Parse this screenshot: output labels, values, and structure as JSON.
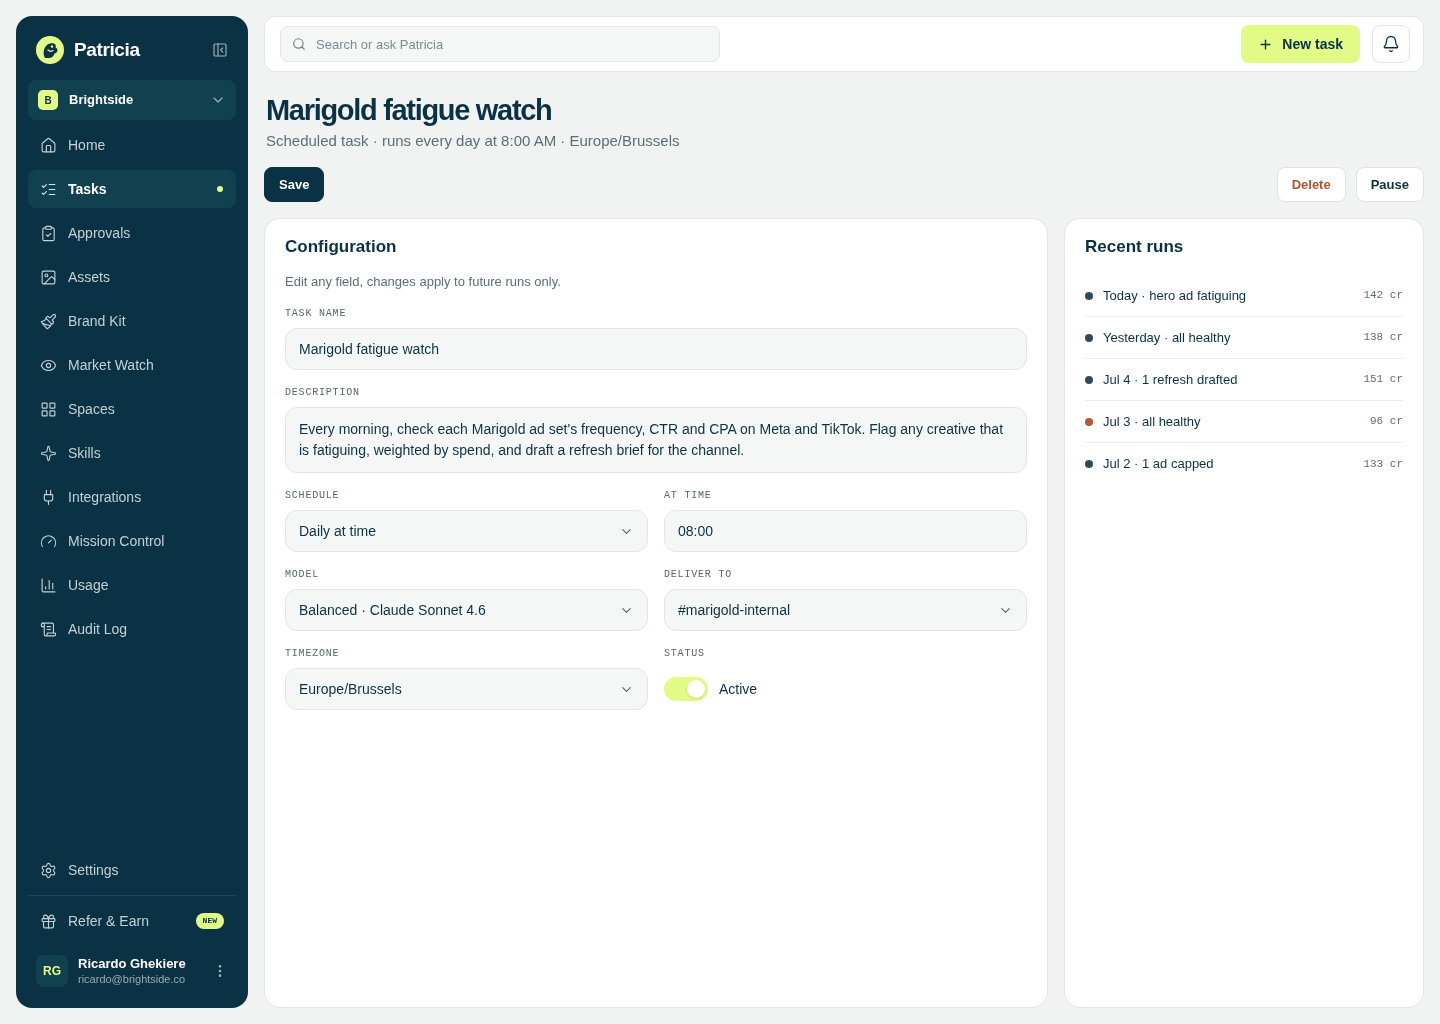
{
  "sidebar": {
    "brand": "Patricia",
    "workspace": {
      "badge": "B",
      "name": "Brightside"
    },
    "nav": [
      {
        "label": "Home",
        "selected": false,
        "has_update": false
      },
      {
        "label": "Tasks",
        "selected": true,
        "has_update": true
      },
      {
        "label": "Approvals",
        "selected": false,
        "has_update": false
      },
      {
        "label": "Assets",
        "selected": false,
        "has_update": false
      },
      {
        "label": "Brand Kit",
        "selected": false,
        "has_update": false
      },
      {
        "label": "Market Watch",
        "selected": false,
        "has_update": false
      },
      {
        "label": "Spaces",
        "selected": false,
        "has_update": false
      },
      {
        "label": "Skills",
        "selected": false,
        "has_update": false
      },
      {
        "label": "Integrations",
        "selected": false,
        "has_update": false
      },
      {
        "label": "Mission Control",
        "selected": false,
        "has_update": false
      },
      {
        "label": "Usage",
        "selected": false,
        "has_update": false
      },
      {
        "label": "Audit Log",
        "selected": false,
        "has_update": false
      }
    ],
    "settings": {
      "label": "Settings"
    },
    "refer": {
      "label": "Refer & Earn",
      "badge": "NEW"
    },
    "user": {
      "initials": "RG",
      "name": "Ricardo Ghekiere",
      "email": "ricardo@brightside.co"
    }
  },
  "topbar": {
    "search": {
      "placeholder": "Search or ask Patricia"
    },
    "new_task_button": "New task"
  },
  "header": {
    "title": "Marigold fatigue watch",
    "subtitle": "Scheduled task · runs every day at 8:00 AM · Europe/Brussels",
    "buttons": [
      {
        "label": "Save",
        "kind": "primary"
      },
      {
        "label": "Delete",
        "kind": "danger"
      },
      {
        "label": "Pause",
        "kind": "secondary"
      }
    ]
  },
  "configuration": {
    "title": "Configuration",
    "hint": "Edit any field, changes apply to future runs only.",
    "fields": [
      {
        "label": "TASK NAME",
        "kind": "text",
        "value": "Marigold fatigue watch"
      },
      {
        "label": "DESCRIPTION",
        "kind": "textarea",
        "value": "Every morning, check each Marigold ad set's frequency, CTR and CPA on Meta and TikTok. Flag any creative that is fatiguing, weighted by spend, and draft a refresh brief for the channel."
      }
    ],
    "grid": [
      {
        "label": "SCHEDULE",
        "kind": "select",
        "value": "Daily at time"
      },
      {
        "label": "AT TIME",
        "kind": "text",
        "value": "08:00"
      },
      {
        "label": "MODEL",
        "kind": "select",
        "value": "Balanced · Claude Sonnet 4.6"
      },
      {
        "label": "DELIVER TO",
        "kind": "select",
        "value": "#marigold-internal"
      },
      {
        "label": "TIMEZONE",
        "kind": "select",
        "value": "Europe/Brussels"
      },
      {
        "label": "STATUS",
        "kind": "toggle",
        "on": true,
        "value": "Active"
      }
    ]
  },
  "recent_runs": {
    "title": "Recent runs",
    "runs": [
      {
        "label": "Today · hero ad fatiguing",
        "credits": "142 cr",
        "color": "#2d4c58"
      },
      {
        "label": "Yesterday · all healthy",
        "credits": "138 cr",
        "color": "#2d4c58"
      },
      {
        "label": "Jul 4 · 1 refresh drafted",
        "credits": "151 cr",
        "color": "#2d4c58"
      },
      {
        "label": "Jul 3 · all healthy",
        "credits": "96 cr",
        "color": "#b5582b"
      },
      {
        "label": "Jul 2 · 1 ad capped",
        "credits": "133 cr",
        "color": "#2d4c58"
      }
    ]
  }
}
